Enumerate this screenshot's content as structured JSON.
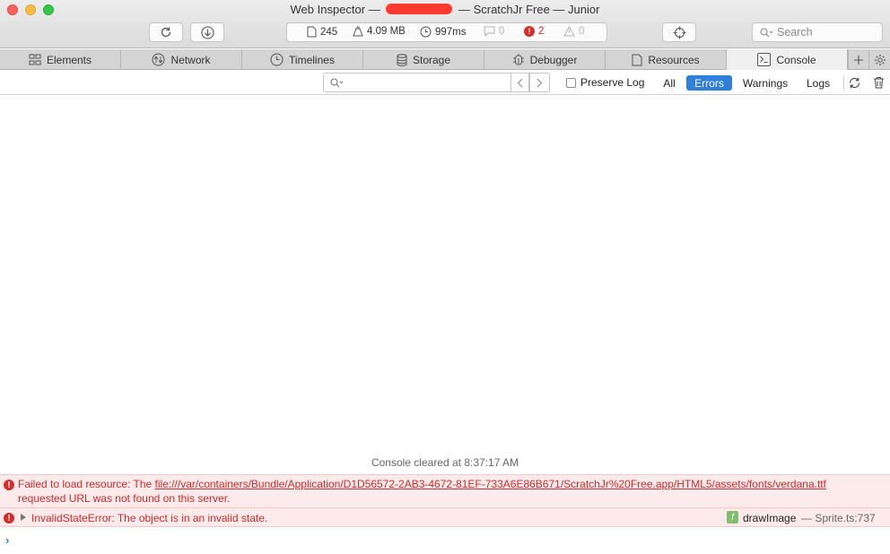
{
  "window": {
    "title_prefix": "Web Inspector —",
    "title_suffix": "— ScratchJr Free — Junior"
  },
  "toolbar": {
    "reload_icon": "reload-icon",
    "download_icon": "download-icon",
    "resource_count": "245",
    "resource_size": "4.09 MB",
    "load_time": "997ms",
    "log_count": "0",
    "error_count": "2",
    "warning_count": "0",
    "target_icon": "crosshair-icon",
    "search_placeholder": "Search"
  },
  "tabs": [
    {
      "label": "Elements",
      "icon": "elements-icon"
    },
    {
      "label": "Network",
      "icon": "network-icon"
    },
    {
      "label": "Timelines",
      "icon": "timelines-icon"
    },
    {
      "label": "Storage",
      "icon": "storage-icon"
    },
    {
      "label": "Debugger",
      "icon": "debugger-icon"
    },
    {
      "label": "Resources",
      "icon": "resources-icon"
    },
    {
      "label": "Console",
      "icon": "console-icon",
      "active": true
    }
  ],
  "filterbar": {
    "filter_value": "",
    "preserve_log_label": "Preserve Log",
    "scopes": [
      "All",
      "Errors",
      "Warnings",
      "Logs"
    ],
    "active_scope": "Errors"
  },
  "console": {
    "cleared_text": "Console cleared at 8:37:17 AM",
    "messages": [
      {
        "level": "error",
        "prefix": "Failed to load resource: The ",
        "url": "file:///var/containers/Bundle/Application/D1D56572-2AB3-4672-81EF-733A6E86B671/ScratchJr%20Free.app/HTML5/assets/fonts/verdana.ttf",
        "suffix": "requested URL was not found on this server."
      },
      {
        "level": "error",
        "text": "InvalidStateError: The object is in an invalid state.",
        "function_badge": "f",
        "function_name": "drawImage",
        "location": "— Sprite.ts:737"
      }
    ],
    "prompt_symbol": "›"
  },
  "colors": {
    "error_red": "#d12b2b",
    "error_bg": "#fdeaea",
    "accent_blue": "#2f7fdb"
  }
}
